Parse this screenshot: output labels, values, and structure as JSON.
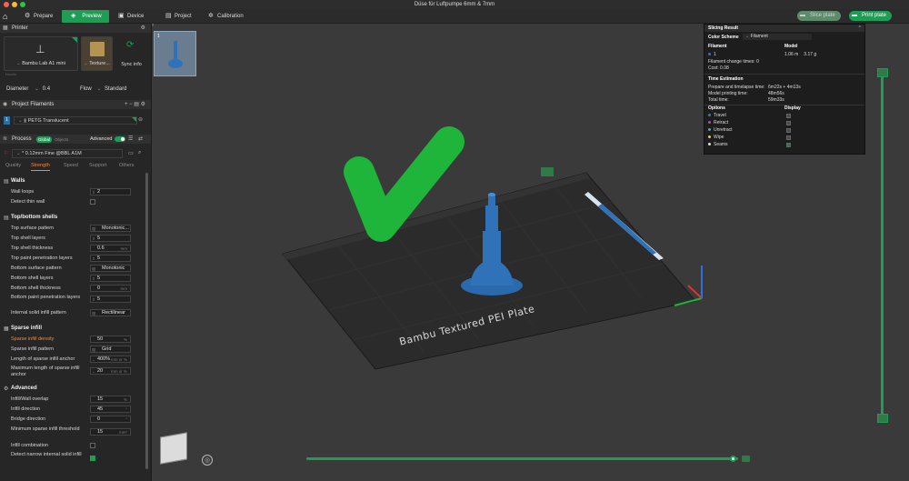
{
  "window": {
    "title": "Düse für Luftpumpe 6mm & 7mm"
  },
  "toolbar": {
    "tabs": [
      {
        "label": "Prepare",
        "active": false
      },
      {
        "label": "Preview",
        "active": true
      },
      {
        "label": "Device",
        "active": false
      },
      {
        "label": "Project",
        "active": false
      },
      {
        "label": "Calibration",
        "active": false
      }
    ],
    "slice_label": "Slice plate",
    "print_label": "Print plate"
  },
  "printer": {
    "section_title": "Printer",
    "printer_name": "Bambu Lab A1 mini",
    "plate_label": "Texture...",
    "sync_label": "Sync info",
    "nozzle_heading": "Nozzle",
    "diameter_label": "Diameter",
    "diameter_value": "0.4",
    "flow_label": "Flow",
    "flow_value": "Standard"
  },
  "filaments": {
    "section_title": "Project Filaments",
    "items": [
      {
        "index": "1",
        "name": "PETG Translucent",
        "color": "#2d6da3"
      }
    ]
  },
  "process": {
    "section_title": "Process",
    "toggle_global": "Global",
    "toggle_objects": "Objects",
    "advanced_label": "Advanced",
    "profile": "* 0.12mm Fine @BBL A1M",
    "tabs": [
      "Quality",
      "Strength",
      "Speed",
      "Support",
      "Others"
    ],
    "active_tab": "Strength"
  },
  "settings": {
    "walls_title": "Walls",
    "wall_loops_label": "Wall loops",
    "wall_loops_value": "2",
    "detect_thin_wall_label": "Detect thin wall",
    "topbottom_title": "Top/bottom shells",
    "top_surface_pattern_label": "Top surface pattern",
    "top_surface_pattern_value": "Monotonic...",
    "top_shell_layers_label": "Top shell layers",
    "top_shell_layers_value": "5",
    "top_shell_thickness_label": "Top shell thickness",
    "top_shell_thickness_value": "0.6",
    "top_paint_label": "Top paint penetration layers",
    "top_paint_value": "5",
    "bottom_surface_pattern_label": "Bottom surface pattern",
    "bottom_surface_pattern_value": "Monotonic",
    "bottom_shell_layers_label": "Bottom shell layers",
    "bottom_shell_layers_value": "5",
    "bottom_shell_thickness_label": "Bottom shell thickness",
    "bottom_shell_thickness_value": "0",
    "bottom_paint_label": "Bottom paint penetration layers",
    "bottom_paint_value": "5",
    "internal_solid_label": "Internal solid infill pattern",
    "internal_solid_value": "Rectilinear",
    "sparse_title": "Sparse infill",
    "sparse_density_label": "Sparse infill density",
    "sparse_density_value": "50",
    "sparse_pattern_label": "Sparse infill pattern",
    "sparse_pattern_value": "Grid",
    "anchor_len_label": "Length of sparse infill anchor",
    "anchor_len_value": "400%",
    "anchor_max_label": "Maximum length of sparse infill anchor",
    "anchor_max_value": "20",
    "advanced_title": "Advanced",
    "overlap_label": "Infill/Wall overlap",
    "overlap_value": "15",
    "infill_dir_label": "Infill direction",
    "infill_dir_value": "45",
    "bridge_dir_label": "Bridge direction",
    "bridge_dir_value": "0",
    "min_sparse_label": "Minimum sparse infill threshold",
    "min_sparse_value": "15",
    "infill_comb_label": "Infill combination",
    "detect_narrow_label": "Detect narrow internal solid infill",
    "units": {
      "mm": "mm",
      "percent": "%",
      "mm_or_pct": "mm or %",
      "deg": "°",
      "mm2": "mm²"
    }
  },
  "plate": {
    "label": "Bambu Textured PEI Plate",
    "number": "1"
  },
  "result": {
    "title": "Slicing Result",
    "color_scheme_label": "Color Scheme",
    "color_scheme_value": "Filament",
    "filament_header": "Filament",
    "model_header": "Model",
    "filament_index": "1",
    "length": "1.06 m",
    "weight": "3.17 g",
    "change_times": "Filament change times:  0",
    "cost": "Cost:  0.08",
    "time_title": "Time Estimation",
    "prepare_label": "Prepare and timelapse time:",
    "prepare_value": "6m22s + 4m13s",
    "model_time_label": "Model printing time:",
    "model_time_value": "48m56s",
    "total_label": "Total time:",
    "total_value": "59m33s",
    "options_header": "Options",
    "display_header": "Display",
    "options": [
      {
        "label": "Travel",
        "color": "#3f6fd1"
      },
      {
        "label": "Retract",
        "color": "#c23ec9"
      },
      {
        "label": "Unretract",
        "color": "#2fb4c8"
      },
      {
        "label": "Wipe",
        "color": "#e6d22a"
      },
      {
        "label": "Seams",
        "color": "#e0e0e0"
      }
    ]
  },
  "colors": {
    "accent": "#1f9d55",
    "orange": "#f08a3e",
    "model": "#2f72b8",
    "check": "#1fb43a"
  }
}
